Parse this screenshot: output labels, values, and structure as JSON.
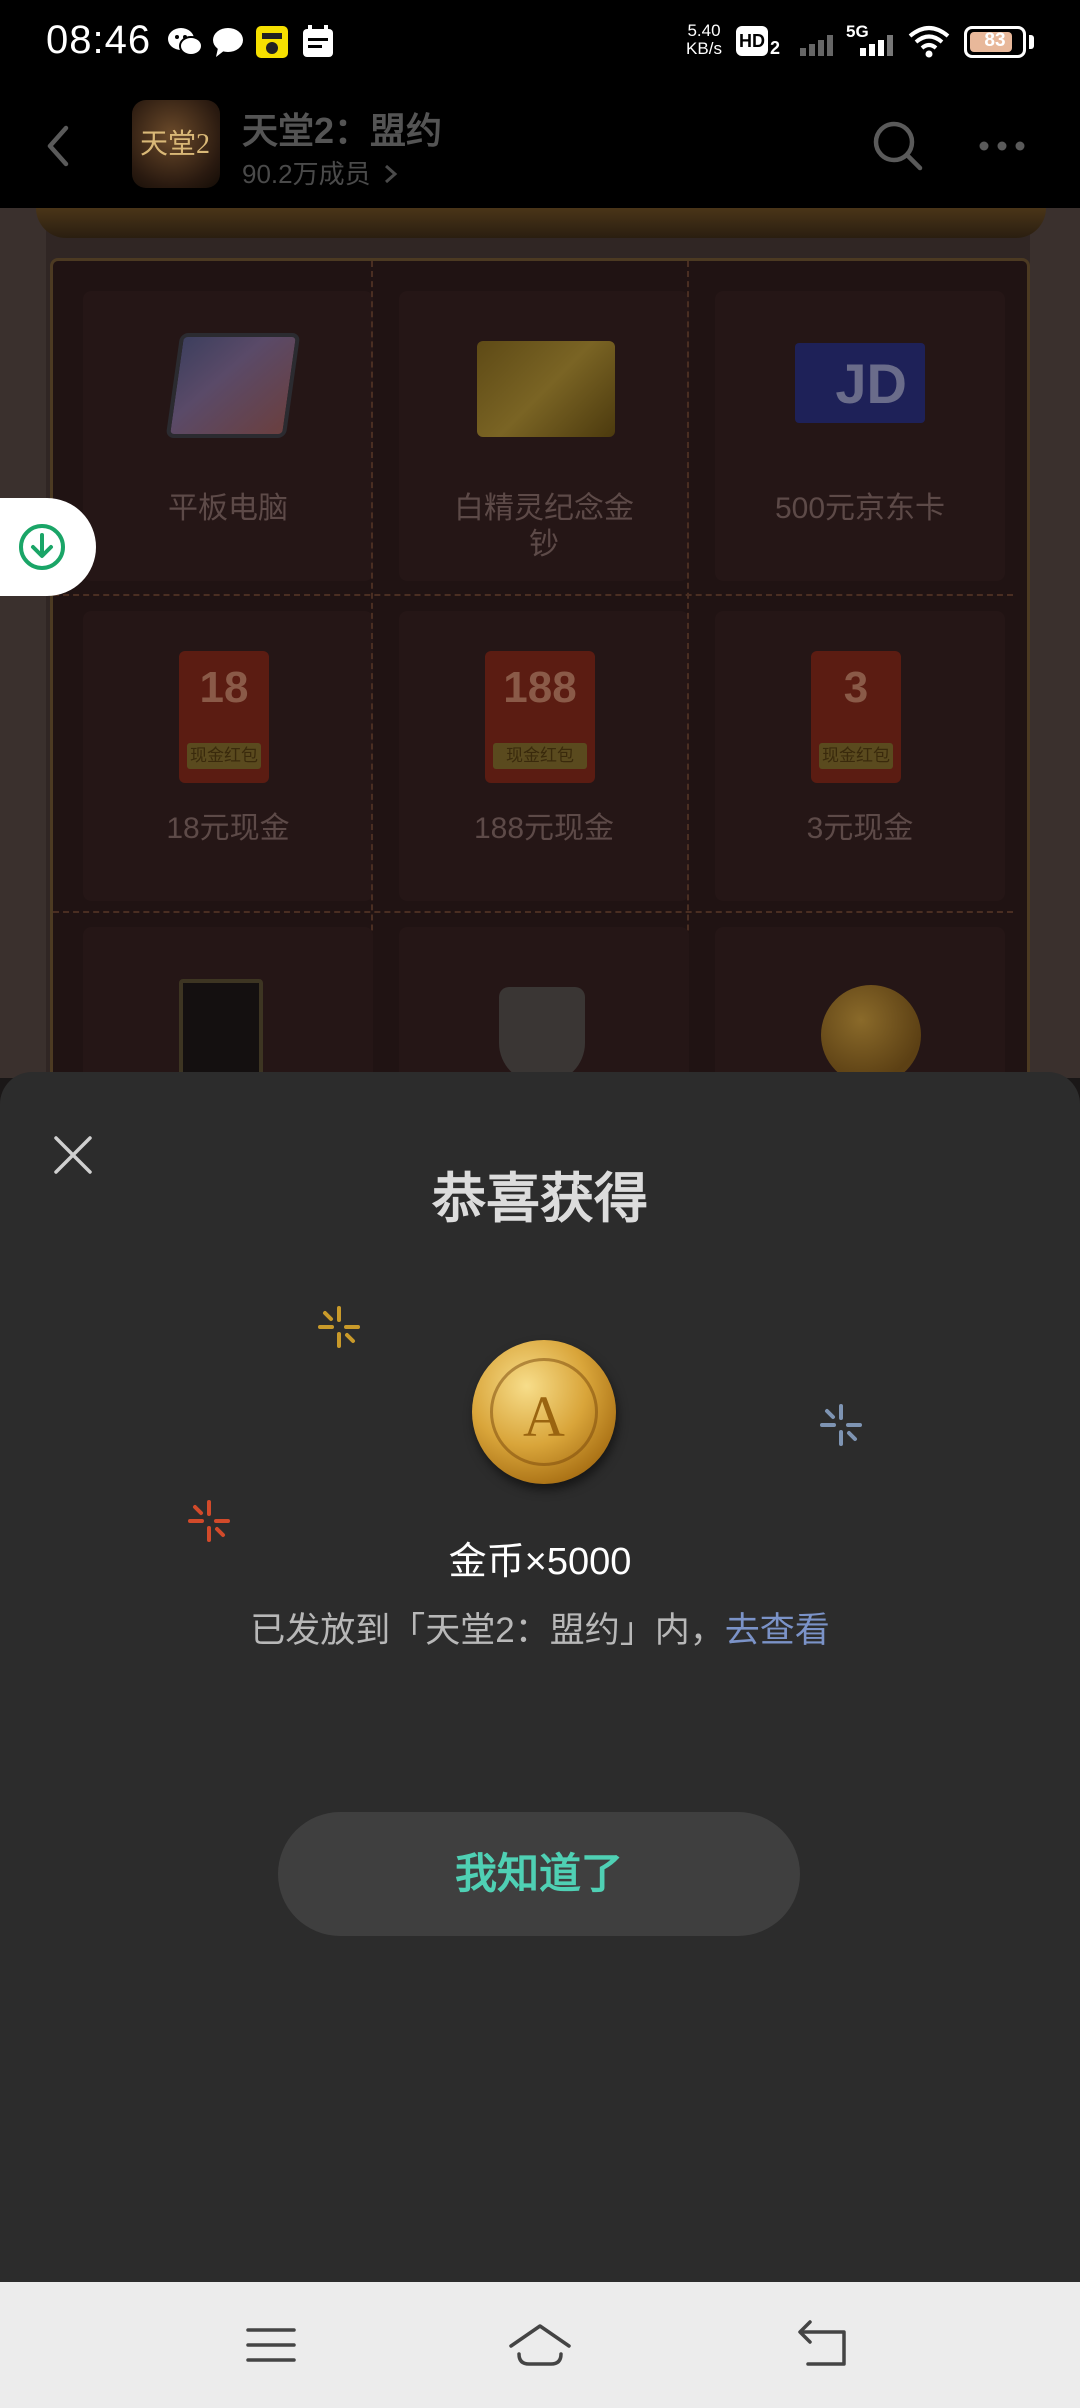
{
  "status_bar": {
    "time": "08:46",
    "net_speed_value": "5.40",
    "net_speed_unit": "KB/s",
    "hd_label": "HD",
    "hd_sub": "2",
    "signal_label": "5G",
    "battery": "83",
    "battery_level": 0.83
  },
  "header": {
    "group_name": "天堂2：盟约",
    "member_count": "90.2万成员",
    "avatar_text": "天堂2"
  },
  "prizes": [
    {
      "label": "平板电脑"
    },
    {
      "label": "白精灵纪念金钞"
    },
    {
      "label": "500元京东卡"
    },
    {
      "label": "18元现金",
      "amount": "18"
    },
    {
      "label": "188元现金",
      "amount": "188"
    },
    {
      "label": "3元现金",
      "amount": "3"
    }
  ],
  "red_packet_label": "现金红包",
  "jd_card_logo": "JD",
  "modal": {
    "title": "恭喜获得",
    "reward_name": "金币×5000",
    "coin_letter": "A",
    "desc_prefix": "已发放到「天堂2：盟约」内，",
    "desc_link": "去查看",
    "ok_label": "我知道了"
  },
  "colors": {
    "accent_green": "#4fd0b4",
    "link_blue": "#7b93c8",
    "download_green": "#1aa567",
    "sheet_bg": "#2c2c2c"
  }
}
